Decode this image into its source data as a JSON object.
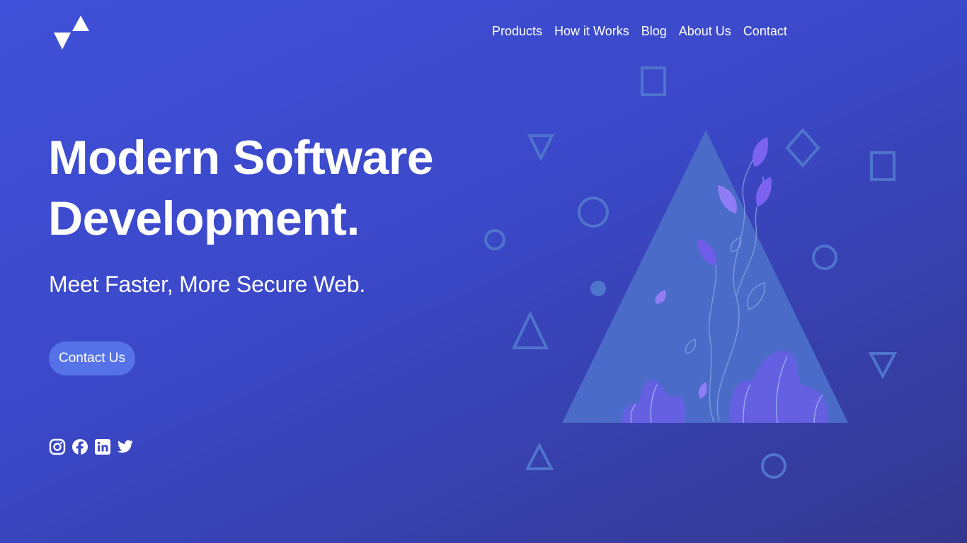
{
  "brand": {
    "logo_icon": "triangles-logo-icon"
  },
  "nav": {
    "items": [
      {
        "label": "Products"
      },
      {
        "label": "How it Works"
      },
      {
        "label": "Blog"
      },
      {
        "label": "About Us"
      },
      {
        "label": "Contact"
      }
    ]
  },
  "hero": {
    "title_line1": "Modern Software",
    "title_line2": "Development.",
    "subtitle": "Meet Faster, More Secure Web.",
    "cta_label": "Contact Us"
  },
  "socials": [
    {
      "icon": "instagram-icon"
    },
    {
      "icon": "facebook-icon"
    },
    {
      "icon": "linkedin-icon"
    },
    {
      "icon": "twitter-icon"
    }
  ],
  "colors": {
    "background_start": "#3f50d8",
    "background_end": "#33388e",
    "button": "#5572e8",
    "triangle_fill": "#4a6cc8",
    "leaf": "#7b63f0",
    "leaf_light": "#8e7df5",
    "shape_outline": "#4f74cc"
  }
}
